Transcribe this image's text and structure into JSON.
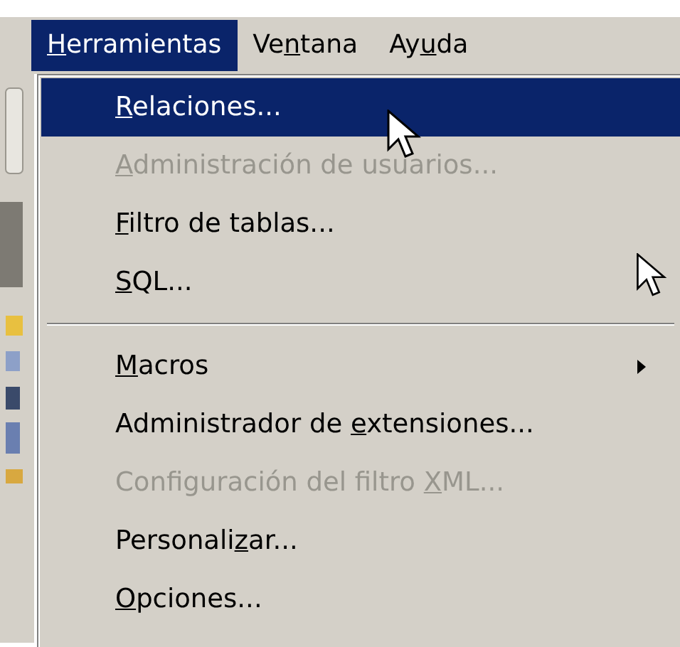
{
  "menubar": [
    {
      "key": "H",
      "after": "erramientas",
      "selected": true
    },
    {
      "before": "Ve",
      "key": "n",
      "after": "tana",
      "selected": false
    },
    {
      "before": "Ay",
      "key": "u",
      "after": "da",
      "selected": false
    }
  ],
  "menu": [
    {
      "kind": "item",
      "key": "R",
      "after": "elaciones...",
      "selected": true,
      "disabled": false
    },
    {
      "kind": "item",
      "key": "A",
      "after": "dministración de usuarios...",
      "selected": false,
      "disabled": true
    },
    {
      "kind": "item",
      "key": "F",
      "after": "iltro de tablas...",
      "selected": false,
      "disabled": false
    },
    {
      "kind": "item",
      "key": "S",
      "after": "QL...",
      "selected": false,
      "disabled": false
    },
    {
      "kind": "separator"
    },
    {
      "kind": "submenu",
      "key": "M",
      "after": "acros",
      "selected": false,
      "disabled": false
    },
    {
      "kind": "item",
      "before": "Administrador de ",
      "key": "e",
      "after": "xtensiones...",
      "selected": false,
      "disabled": false
    },
    {
      "kind": "item",
      "before": "Configuración del filtro ",
      "key": "X",
      "after": "ML...",
      "selected": false,
      "disabled": true
    },
    {
      "kind": "item",
      "before": "Personali",
      "key": "z",
      "after": "ar...",
      "selected": false,
      "disabled": false
    },
    {
      "kind": "item",
      "key": "O",
      "after": "pciones...",
      "selected": false,
      "disabled": false
    }
  ]
}
